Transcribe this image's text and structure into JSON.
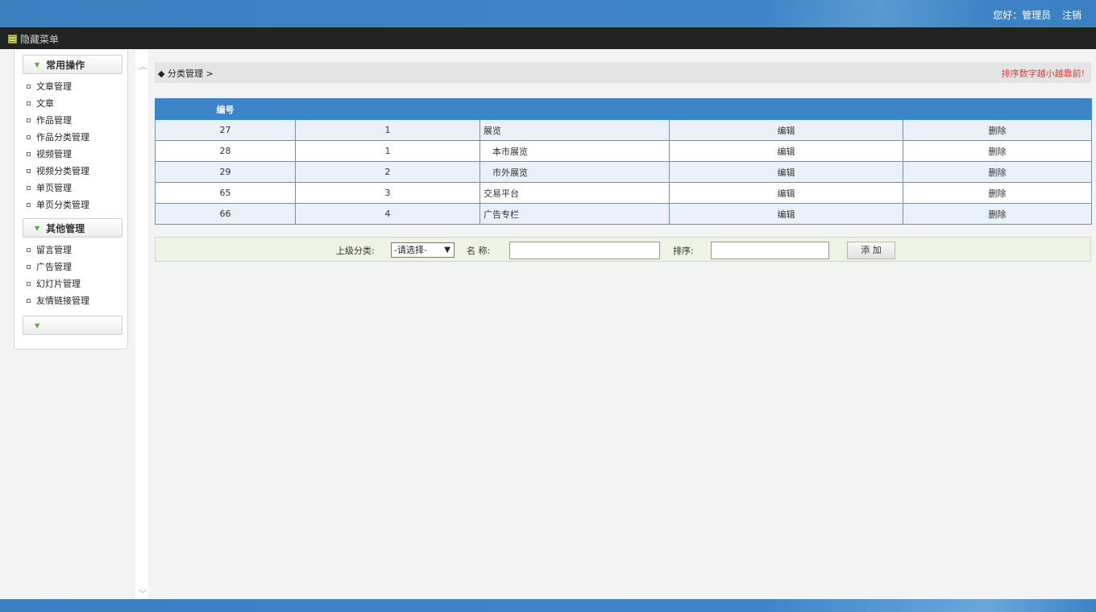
{
  "header": {
    "greeting": "您好：管理员",
    "logout": "注销"
  },
  "menubar": {
    "toggle_label": "隐藏菜单"
  },
  "sidebar": {
    "group1": {
      "title": "常用操作",
      "items": [
        "文章管理",
        "文章",
        "作品管理",
        "作品分类管理",
        "视频管理",
        "视频分类管理",
        "单页管理",
        "单页分类管理"
      ]
    },
    "group2": {
      "title": "其他管理",
      "items": [
        "留言管理",
        "广告管理",
        "幻灯片管理",
        "友情链接管理"
      ]
    },
    "group3": {
      "title": ""
    }
  },
  "breadcrumb": {
    "text": "◆ 分类管理 >",
    "note": "排序数字越小越靠前!"
  },
  "table": {
    "headers": [
      "编号",
      "",
      "",
      "",
      ""
    ],
    "rows": [
      {
        "id": "27",
        "sort": "1",
        "name": "展览",
        "edit": "编辑",
        "delete": "删除"
      },
      {
        "id": "28",
        "sort": "1",
        "name": "　本市展览",
        "edit": "编辑",
        "delete": "删除"
      },
      {
        "id": "29",
        "sort": "2",
        "name": "　市外展览",
        "edit": "编辑",
        "delete": "删除"
      },
      {
        "id": "65",
        "sort": "3",
        "name": "交易平台",
        "edit": "编辑",
        "delete": "删除"
      },
      {
        "id": "66",
        "sort": "4",
        "name": "广告专栏",
        "edit": "编辑",
        "delete": "删除"
      }
    ]
  },
  "add_form": {
    "parent_label": "上级分类:",
    "parent_selected": "-请选择-",
    "name_label": "名 称:",
    "name_value": "",
    "sort_label": "排序:",
    "sort_value": "",
    "add_button": "添 加"
  }
}
